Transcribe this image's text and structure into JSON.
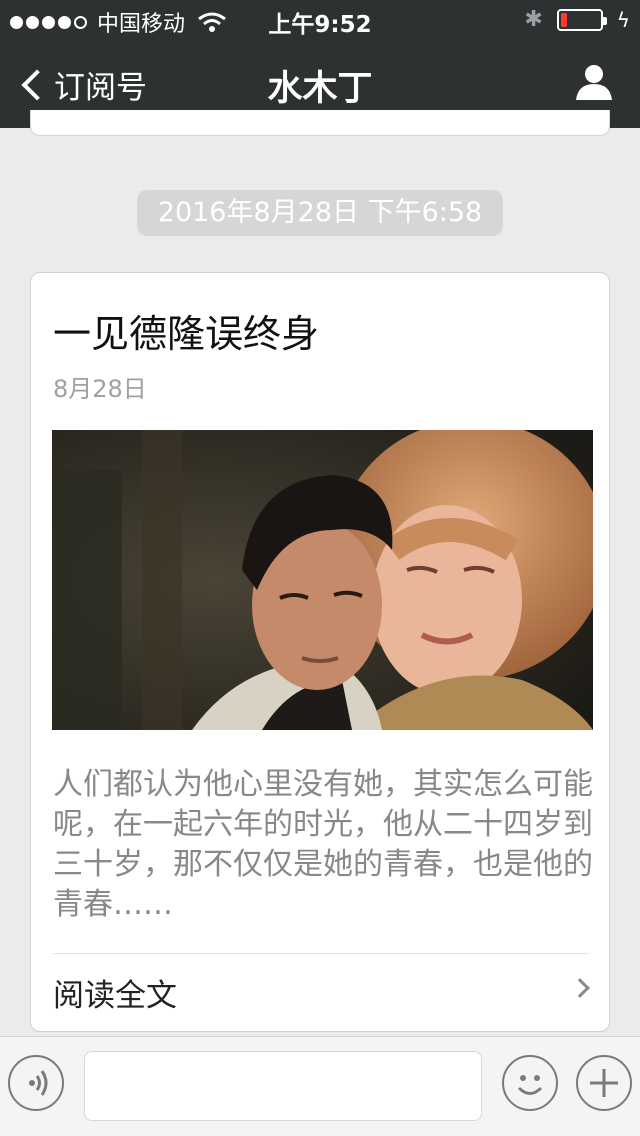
{
  "status_bar": {
    "carrier": "中国移动",
    "time": "上午9:52",
    "battery_level": 0.15
  },
  "nav": {
    "back_label": "订阅号",
    "title": "水木丁"
  },
  "timestamp": "2016年8月28日 下午6:58",
  "article": {
    "title": "一见德隆误终身",
    "date": "8月28日",
    "digest": "人们都认为他心里没有她，其实怎么可能呢，在一起六年的时光，他从二十四岁到三十岁，那不仅仅是她的青春，也是他的青春……",
    "read_more": "阅读全文"
  },
  "colors": {
    "nav_bg": "#2e3132",
    "chat_bg": "#ebebeb",
    "battery_low": "#ff3b30"
  },
  "icons": {
    "back": "chevron-left-icon",
    "profile": "person-icon",
    "voice": "voice-icon",
    "emoji": "smiley-icon",
    "plus": "plus-icon"
  }
}
